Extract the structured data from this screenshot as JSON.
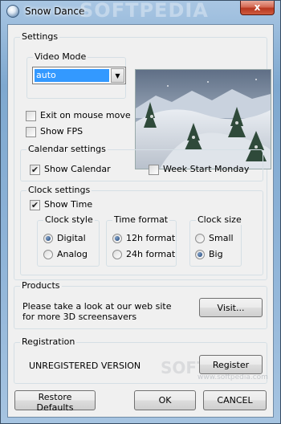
{
  "window": {
    "title": "Snow Dance",
    "watermark": "SOFTPEDIA",
    "close_glyph": "x"
  },
  "settings": {
    "group_label": "Settings",
    "video_mode": {
      "group_label": "Video Mode",
      "selected_value": "auto"
    },
    "exit_on_mouse_move": {
      "label": "Exit on mouse move",
      "checked": false
    },
    "show_fps": {
      "label": "Show FPS",
      "checked": false
    }
  },
  "calendar": {
    "group_label": "Calendar settings",
    "show_calendar": {
      "label": "Show Calendar",
      "checked": true
    },
    "week_start_monday": {
      "label": "Week Start Monday",
      "checked": false
    }
  },
  "clock": {
    "group_label": "Clock settings",
    "show_time": {
      "label": "Show Time",
      "checked": true
    },
    "style": {
      "group_label": "Clock style",
      "options": [
        "Digital",
        "Analog"
      ],
      "selected": "Digital"
    },
    "time_format": {
      "group_label": "Time format",
      "options": [
        "12h format",
        "24h format"
      ],
      "selected": "12h format"
    },
    "size": {
      "group_label": "Clock size",
      "options": [
        "Small",
        "Big"
      ],
      "selected": "Big"
    }
  },
  "products": {
    "group_label": "Products",
    "text_line1": "Please take a look at our web site",
    "text_line2": "for more 3D screensavers",
    "visit_button": "Visit..."
  },
  "registration": {
    "group_label": "Registration",
    "status": "UNREGISTERED VERSION",
    "register_button": "Register",
    "watermark": "SOFTPEDIA",
    "watermark_url": "www.softpedia.com"
  },
  "footer": {
    "restore_defaults": "Restore Defaults",
    "ok": "OK",
    "cancel": "CANCEL"
  },
  "icons": {
    "check": "✔",
    "dropdown": "▼"
  }
}
